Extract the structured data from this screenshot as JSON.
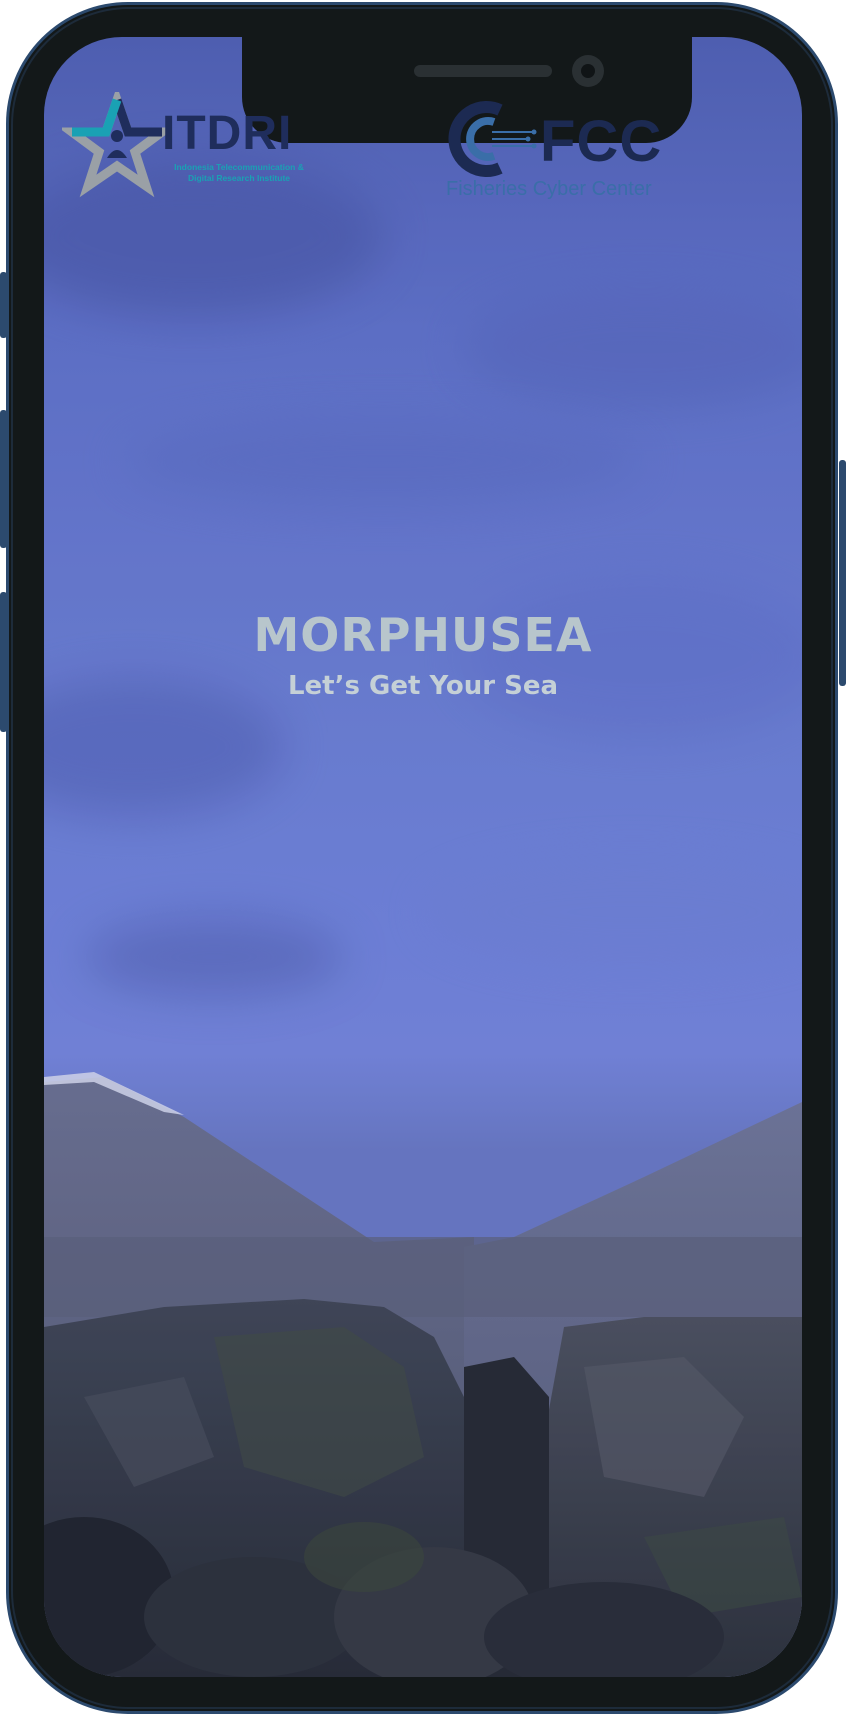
{
  "app": {
    "title": "MORPHUSEA",
    "tagline": "Let’s Get Your Sea"
  },
  "logos": {
    "itdri": {
      "name": "ITDRI",
      "subtitle_line1": "Indonesia Telecommunication &",
      "subtitle_line2": "Digital Research Institute"
    },
    "fcc": {
      "name": "FCC",
      "subtitle": "Fisheries Cyber Center"
    }
  },
  "icons": {
    "itdri_logo": "star-person-icon",
    "fcc_logo": "c-circuit-icon"
  },
  "colors": {
    "sky_top": "#4f5fb0",
    "sky_mid": "#6f82d8",
    "title_text": "#b8c6cc",
    "itdri_navy": "#1f2d5c",
    "itdri_teal": "#1aa1b4",
    "fcc_navy": "#1c2a52",
    "fcc_blue": "#3a6ea8",
    "phone_frame": "#2c4a6e"
  }
}
